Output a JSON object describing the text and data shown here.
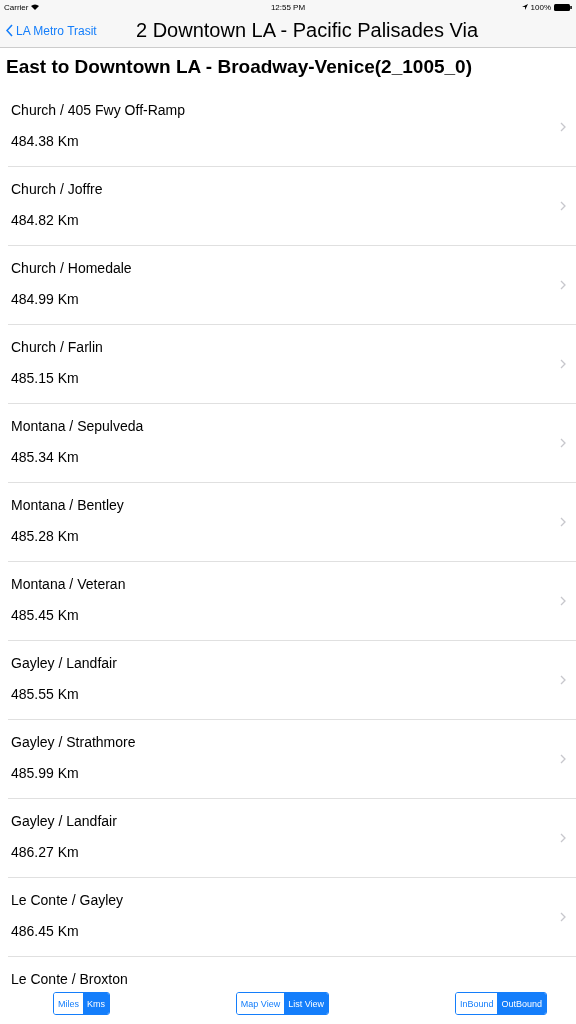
{
  "status_bar": {
    "carrier": "Carrier",
    "time": "12:55 PM",
    "battery": "100%"
  },
  "nav_bar": {
    "back": "LA Metro Trasit",
    "title": "2 Downtown LA - Pacific Palisades Via"
  },
  "direction_title": "East to Downtown LA - Broadway-Venice(2_1005_0)",
  "stops": [
    {
      "name": "Church / 405 Fwy Off-Ramp",
      "distance": "484.38 Km"
    },
    {
      "name": "Church / Joffre",
      "distance": "484.82 Km"
    },
    {
      "name": "Church / Homedale",
      "distance": "484.99 Km"
    },
    {
      "name": "Church / Farlin",
      "distance": "485.15 Km"
    },
    {
      "name": "Montana / Sepulveda",
      "distance": "485.34 Km"
    },
    {
      "name": "Montana / Bentley",
      "distance": "485.28 Km"
    },
    {
      "name": "Montana / Veteran",
      "distance": "485.45 Km"
    },
    {
      "name": "Gayley / Landfair",
      "distance": "485.55 Km"
    },
    {
      "name": "Gayley / Strathmore",
      "distance": "485.99 Km"
    },
    {
      "name": "Gayley / Landfair",
      "distance": "486.27 Km"
    },
    {
      "name": "Le Conte / Gayley",
      "distance": "486.45 Km"
    },
    {
      "name": "Le Conte / Broxton"
    }
  ],
  "segmented_controls": [
    {
      "options": [
        {
          "label": "Miles",
          "selected": false
        },
        {
          "label": "Kms",
          "selected": true
        }
      ]
    },
    {
      "options": [
        {
          "label": "Map View",
          "selected": false
        },
        {
          "label": "List View",
          "selected": true
        }
      ]
    },
    {
      "options": [
        {
          "label": "InBound",
          "selected": false
        },
        {
          "label": "OutBound",
          "selected": true
        }
      ]
    }
  ]
}
